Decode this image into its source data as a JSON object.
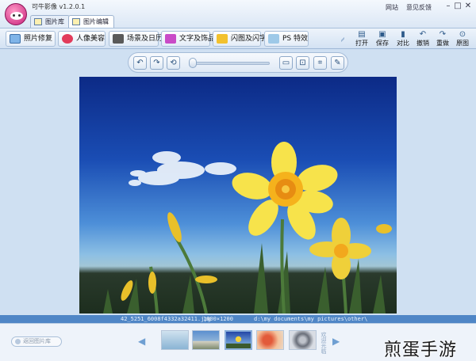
{
  "app": {
    "title": "可牛影像 v1.2.0.1",
    "tabs": [
      {
        "label": "图片库",
        "active": false
      },
      {
        "label": "图片编辑",
        "active": true
      }
    ],
    "links": {
      "site": "网站",
      "feedback": "意见反馈"
    },
    "window": {
      "min": "–",
      "max": "□",
      "close": "✕"
    }
  },
  "toolbar": {
    "categories": [
      {
        "label": "照片修复",
        "icon": "photo-repair-icon"
      },
      {
        "label": "人像美容",
        "icon": "portrait-beauty-icon"
      },
      {
        "label": "场景及日历",
        "icon": "scene-calendar-icon"
      },
      {
        "label": "文字及饰品",
        "icon": "text-decoration-icon"
      },
      {
        "label": "闪图及闪字",
        "icon": "flash-image-icon"
      },
      {
        "label": "PS 特效",
        "icon": "ps-effects-icon"
      }
    ],
    "actions": [
      {
        "label": "打开",
        "icon": "open-folder-icon",
        "glyph": "▤"
      },
      {
        "label": "保存",
        "icon": "save-disk-icon",
        "glyph": "▣"
      },
      {
        "label": "对比",
        "icon": "compare-icon",
        "glyph": "▮"
      },
      {
        "label": "撤销",
        "icon": "undo-icon",
        "glyph": "↶"
      },
      {
        "label": "重做",
        "icon": "redo-icon",
        "glyph": "↷"
      },
      {
        "label": "原图",
        "icon": "original-image-icon",
        "glyph": "⊙"
      }
    ]
  },
  "controls": {
    "rotate_left": "↶",
    "rotate_right": "↷",
    "refresh": "⟲",
    "zoom_level": 0.0,
    "fit_window": "▭",
    "actual_size": "⊡",
    "crop": "⌗",
    "pencil": "✎"
  },
  "status": {
    "filename": "42_5251_6008f4332a32411.jpg",
    "dimensions": "1600×1200",
    "path": "d:\\my documents\\my pictures\\other\\"
  },
  "filmstrip": {
    "back_label": "返回图片库",
    "prev": "◀",
    "next": "▶",
    "vertical_label": "欢迎光临"
  },
  "watermark": "煎蛋手游"
}
